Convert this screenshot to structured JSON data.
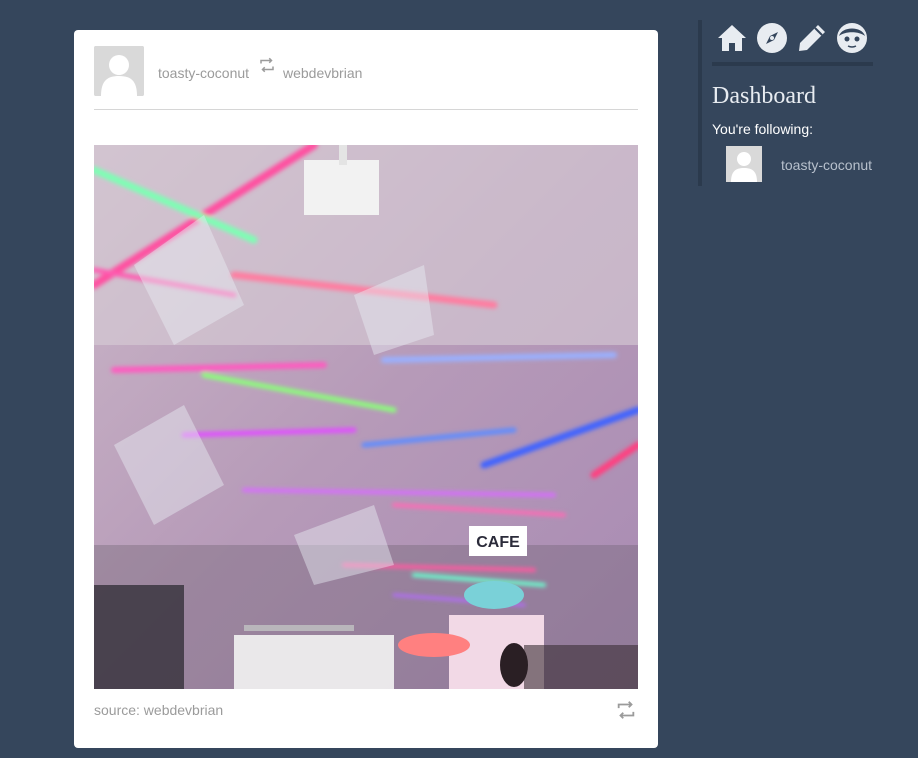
{
  "post": {
    "author": "toasty-coconut",
    "reblogged_from": "webdevbrian",
    "source_label": "source: webdevbrian",
    "photo_sign_text": "CAFE",
    "icons": {
      "reblog_header": "reblog-icon",
      "reblog_footer": "reblog-icon"
    }
  },
  "sidebar": {
    "nav": [
      {
        "name": "home-icon"
      },
      {
        "name": "compass-icon"
      },
      {
        "name": "pencil-icon"
      },
      {
        "name": "face-icon"
      }
    ],
    "title": "Dashboard",
    "following_label": "You're following:",
    "following": [
      {
        "name": "toasty-coconut"
      }
    ]
  },
  "colors": {
    "background": "#35465c",
    "card": "#ffffff",
    "muted_text": "#9b9b9b",
    "sidebar_border": "#2b3a4d"
  }
}
